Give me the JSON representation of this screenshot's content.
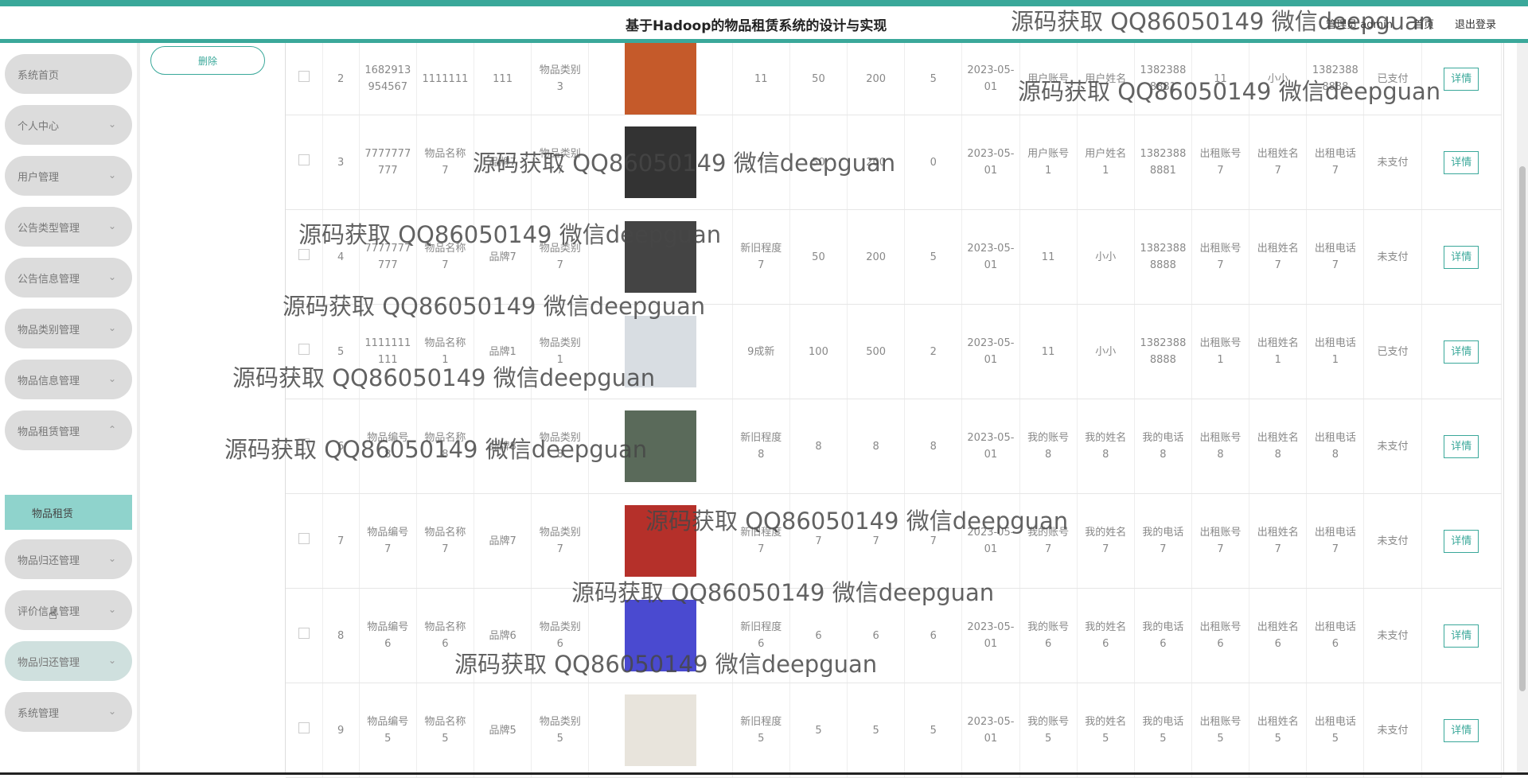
{
  "header": {
    "title": "基于Hadoop的物品租赁系统的设计与实现",
    "user_label": "管理员 admin",
    "home_link": "首页",
    "logout_link": "退出登录"
  },
  "sidebar": {
    "items": [
      {
        "label": "系统首页"
      },
      {
        "label": "个人中心"
      },
      {
        "label": "用户管理"
      },
      {
        "label": "公告类型管理"
      },
      {
        "label": "公告信息管理"
      },
      {
        "label": "物品类别管理"
      },
      {
        "label": "物品信息管理"
      },
      {
        "label": "物品租赁管理"
      },
      {
        "label": "物品归还管理"
      },
      {
        "label": "评价信息管理"
      },
      {
        "label": "物品归还管理"
      },
      {
        "label": "系统管理"
      }
    ],
    "submenu_label": "物品租赁"
  },
  "toolbar": {
    "delete_label": "删除"
  },
  "table": {
    "detail_label": "详情",
    "rows": [
      {
        "idx": "2",
        "c1": "1682913954567",
        "c2": "1111111",
        "c3": "111",
        "c4": "物品类别3",
        "c5": "11",
        "c6": "50",
        "c7": "200",
        "c8": "5",
        "c9": "2023-05-01",
        "c10": "用户账号",
        "c11": "用户姓名",
        "c12": "13823888881",
        "c13": "11",
        "c14": "小小",
        "c15": "13823888888",
        "c16": "已支付",
        "img": "#c55a2a"
      },
      {
        "idx": "3",
        "c1": "7777777777",
        "c2": "物品名称7",
        "c3": "品牌7",
        "c4": "物品类别7",
        "c5": "7",
        "c6": "50",
        "c7": "200",
        "c8": "0",
        "c9": "2023-05-01",
        "c10": "用户账号1",
        "c11": "用户姓名1",
        "c12": "13823888881",
        "c13": "出租账号7",
        "c14": "出租姓名7",
        "c15": "出租电话7",
        "c16": "未支付",
        "img": "#333333"
      },
      {
        "idx": "4",
        "c1": "7777777777",
        "c2": "物品名称7",
        "c3": "品牌7",
        "c4": "物品类别7",
        "c5": "新旧程度7",
        "c6": "50",
        "c7": "200",
        "c8": "5",
        "c9": "2023-05-01",
        "c10": "11",
        "c11": "小小",
        "c12": "13823888888",
        "c13": "出租账号7",
        "c14": "出租姓名7",
        "c15": "出租电话7",
        "c16": "未支付",
        "img": "#444444"
      },
      {
        "idx": "5",
        "c1": "1111111111",
        "c2": "物品名称1",
        "c3": "品牌1",
        "c4": "物品类别1",
        "c5": "9成新",
        "c6": "100",
        "c7": "500",
        "c8": "2",
        "c9": "2023-05-01",
        "c10": "11",
        "c11": "小小",
        "c12": "13823888888",
        "c13": "出租账号1",
        "c14": "出租姓名1",
        "c15": "出租电话1",
        "c16": "已支付",
        "img": "#d8dde2"
      },
      {
        "idx": "6",
        "c1": "物品编号8",
        "c2": "物品名称8",
        "c3": "品牌8",
        "c4": "物品类别8",
        "c5": "新旧程度8",
        "c6": "8",
        "c7": "8",
        "c8": "8",
        "c9": "2023-05-01",
        "c10": "我的账号8",
        "c11": "我的姓名8",
        "c12": "我的电话8",
        "c13": "出租账号8",
        "c14": "出租姓名8",
        "c15": "出租电话8",
        "c16": "未支付",
        "img": "#5a6a5a"
      },
      {
        "idx": "7",
        "c1": "物品编号7",
        "c2": "物品名称7",
        "c3": "品牌7",
        "c4": "物品类别7",
        "c5": "新旧程度7",
        "c6": "7",
        "c7": "7",
        "c8": "7",
        "c9": "2023-05-01",
        "c10": "我的账号7",
        "c11": "我的姓名7",
        "c12": "我的电话7",
        "c13": "出租账号7",
        "c14": "出租姓名7",
        "c15": "出租电话7",
        "c16": "未支付",
        "img": "#b5302a"
      },
      {
        "idx": "8",
        "c1": "物品编号6",
        "c2": "物品名称6",
        "c3": "品牌6",
        "c4": "物品类别6",
        "c5": "新旧程度6",
        "c6": "6",
        "c7": "6",
        "c8": "6",
        "c9": "2023-05-01",
        "c10": "我的账号6",
        "c11": "我的姓名6",
        "c12": "我的电话6",
        "c13": "出租账号6",
        "c14": "出租姓名6",
        "c15": "出租电话6",
        "c16": "未支付",
        "img": "#4a4ad0"
      },
      {
        "idx": "9",
        "c1": "物品编号5",
        "c2": "物品名称5",
        "c3": "品牌5",
        "c4": "物品类别5",
        "c5": "新旧程度5",
        "c6": "5",
        "c7": "5",
        "c8": "5",
        "c9": "2023-05-01",
        "c10": "我的账号5",
        "c11": "我的姓名5",
        "c12": "我的电话5",
        "c13": "出租账号5",
        "c14": "出租姓名5",
        "c15": "出租电话5",
        "c16": "未支付",
        "img": "#e8e4dc"
      }
    ]
  },
  "watermark_text": "源码获取 QQ86050149 微信deepguan",
  "colors": {
    "accent": "#3aa89a",
    "submenu": "#8fd3cc"
  }
}
